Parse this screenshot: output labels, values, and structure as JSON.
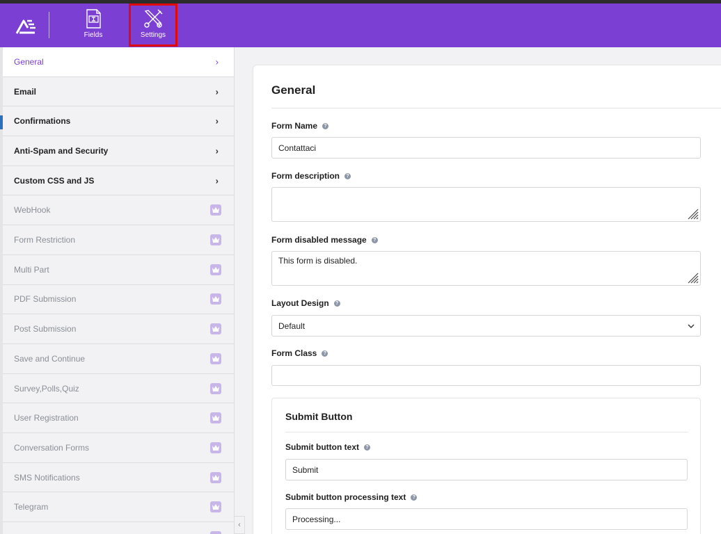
{
  "header": {
    "bg_color": "#7b3fd3",
    "logo_icon": "logo-icon",
    "tools": [
      {
        "label": "Fields",
        "icon": "fields-icon"
      },
      {
        "label": "Settings",
        "icon": "settings-icon",
        "highlighted": true
      }
    ]
  },
  "sidebar": {
    "items": [
      {
        "label": "General",
        "state": "active",
        "icon": "chevron-right-icon"
      },
      {
        "label": "Email",
        "state": "normal",
        "icon": "chevron-right-icon"
      },
      {
        "label": "Confirmations",
        "state": "normal",
        "icon": "chevron-right-icon"
      },
      {
        "label": "Anti-Spam and Security",
        "state": "normal",
        "icon": "chevron-right-icon"
      },
      {
        "label": "Custom CSS and JS",
        "state": "normal",
        "icon": "chevron-right-icon"
      },
      {
        "label": "WebHook",
        "state": "pro",
        "icon": "crown-icon"
      },
      {
        "label": "Form Restriction",
        "state": "pro",
        "icon": "crown-icon"
      },
      {
        "label": "Multi Part",
        "state": "pro",
        "icon": "crown-icon"
      },
      {
        "label": "PDF Submission",
        "state": "pro",
        "icon": "crown-icon"
      },
      {
        "label": "Post Submission",
        "state": "pro",
        "icon": "crown-icon"
      },
      {
        "label": "Save and Continue",
        "state": "pro",
        "icon": "crown-icon"
      },
      {
        "label": "Survey,Polls,Quiz",
        "state": "pro",
        "icon": "crown-icon"
      },
      {
        "label": "User Registration",
        "state": "pro",
        "icon": "crown-icon"
      },
      {
        "label": "Conversation Forms",
        "state": "pro",
        "icon": "crown-icon"
      },
      {
        "label": "SMS Notifications",
        "state": "pro",
        "icon": "crown-icon"
      },
      {
        "label": "Telegram",
        "state": "pro",
        "icon": "crown-icon"
      },
      {
        "label": "",
        "state": "pro",
        "icon": "crown-icon"
      }
    ],
    "collapse_glyph": "‹"
  },
  "main": {
    "title": "General",
    "form_name": {
      "label": "Form Name",
      "value": "Contattaci"
    },
    "form_description": {
      "label": "Form description",
      "value": ""
    },
    "form_disabled_message": {
      "label": "Form disabled message",
      "value": "This form is disabled."
    },
    "layout_design": {
      "label": "Layout Design",
      "value": "Default"
    },
    "form_class": {
      "label": "Form Class",
      "value": ""
    },
    "submit_button": {
      "title": "Submit Button",
      "text": {
        "label": "Submit button text",
        "value": "Submit"
      },
      "processing_text": {
        "label": "Submit button processing text",
        "value": "Processing..."
      }
    }
  }
}
